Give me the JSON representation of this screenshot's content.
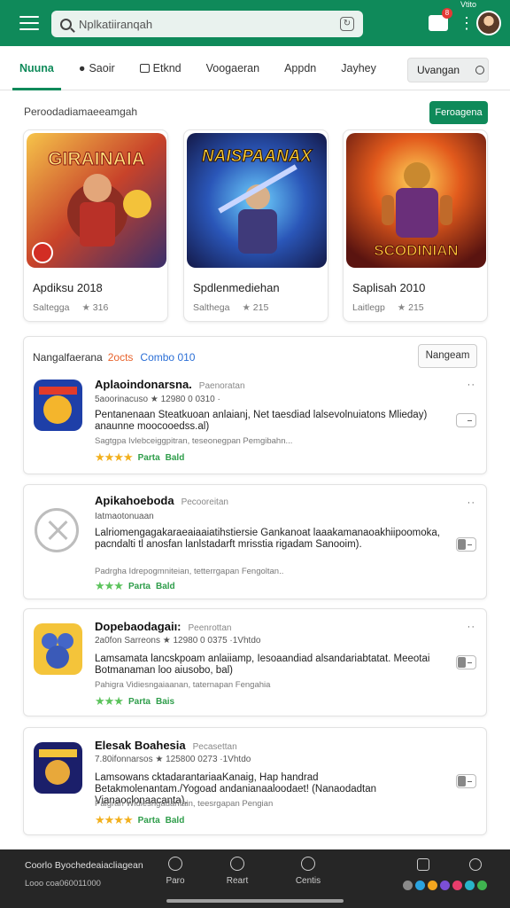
{
  "header": {
    "search_placeholder": "Nplkatiiranqah",
    "notification_badge": "8",
    "small_label": "Vtito",
    "icons": [
      "menu-icon",
      "search-icon",
      "clear-icon",
      "notification-icon",
      "more-icon",
      "avatar"
    ]
  },
  "tabs": [
    {
      "label": "Nuuna",
      "active": true
    },
    {
      "label": "Saoir",
      "active": false
    },
    {
      "label": "Etknd",
      "active": false
    },
    {
      "label": "Voogaeran",
      "active": false
    },
    {
      "label": "Appdn",
      "active": false
    },
    {
      "label": "Jayhey",
      "active": false
    }
  ],
  "tab_search_button": "Uvangan",
  "featured": {
    "title": "Peroodadiamaeeamgah",
    "button": "Feroagena",
    "items": [
      {
        "art_title": "GIRAINAIA",
        "name": "Apdiksu 2018",
        "sub": "Saltegga",
        "rating": "316"
      },
      {
        "art_title": "NAISPAANAX",
        "name": "Spdlenmediehan",
        "sub": "Salthega",
        "rating": "215"
      },
      {
        "art_title": "SCODINIAN",
        "name": "Saplisah 2010",
        "sub": "Laitlegp",
        "rating": "215"
      }
    ]
  },
  "list": {
    "title": "Nangalfaerana",
    "count_red": "2octs",
    "count_blue": "Combo 010",
    "button": "Nangeam",
    "apps": [
      {
        "title": "Aplaoindonarsna.",
        "category": "Paenoratan",
        "meta": "5aoorinacuso  ★ 12980 0 0310  ·",
        "desc": "Pentanenaan Steatkuoan anlaianj, Net taesdiad lalsevolnuiatons Mlieday) anaunne moocooedss.al)",
        "tags": "Sagtgpa Ivlebceiggpitran, teseonegpan Pemgibahn...",
        "rating_label": "Parta",
        "badge": "Bald"
      },
      {
        "title": "Apikahoeboda",
        "category": "Pecooreitan",
        "meta": "Iatmaotonuaan",
        "desc": "Lalriomengagakaraeaiaaiatihstiersie Gankanoat laaakamanaoakhiipoomoka, pacndalti tl anosfan lanlstadarft mrisstia rigadam Sanooim).",
        "tags": "Padrgha Idrepogmniteian, tetterrgapan Fengoltan..",
        "rating_label": "Parta",
        "badge": "Bald"
      },
      {
        "title": "Dopebaodagaiı:",
        "category": "Peenrottan",
        "meta": "2a0fon Sarreons  ★ 12980 0 0375  ·1Vhtdo",
        "desc": "Lamsamata lancskpoam anlaiiamp, Iesoaandiad alsandariabtatat. Meeotai Botmanaman loo aiusobo, bal)",
        "tags": "Pahigra Vidiesngaiaanan, taternapan Fengahia",
        "rating_label": "Parta",
        "badge": "Bais"
      },
      {
        "title": "Elesak Boahesia",
        "category": "Pecasettan",
        "meta": "7.80ifonnarsos  ★ 125800 0273  ·1Vhtdo",
        "desc": "Lamsowans cktadarantariaaKanaig, Hap handrad Betakmolenantam./Yogoad andanianaaloodaet! (Nanaodadtan Vianaoclonaacanta).",
        "tags": "Paigrah Widiesngadanfain, teesrgapan Pengian",
        "rating_label": "Parta",
        "badge": "Bald"
      }
    ]
  },
  "bottom": {
    "line1": "Coorlo Byochedeaiacliagean",
    "line2": "Looo coa060011000",
    "nav": [
      {
        "label": "Paro"
      },
      {
        "label": "Reart"
      },
      {
        "label": "Centis"
      }
    ],
    "social_colors": [
      "#8a8a8a",
      "#2aa3e0",
      "#f2a61e",
      "#7b4fd6",
      "#e83d6b",
      "#29b3c9",
      "#3fb34f"
    ]
  },
  "colors": {
    "brand": "#0f8a5a",
    "bottom_bar": "#262626",
    "star": "#f2b01e"
  }
}
